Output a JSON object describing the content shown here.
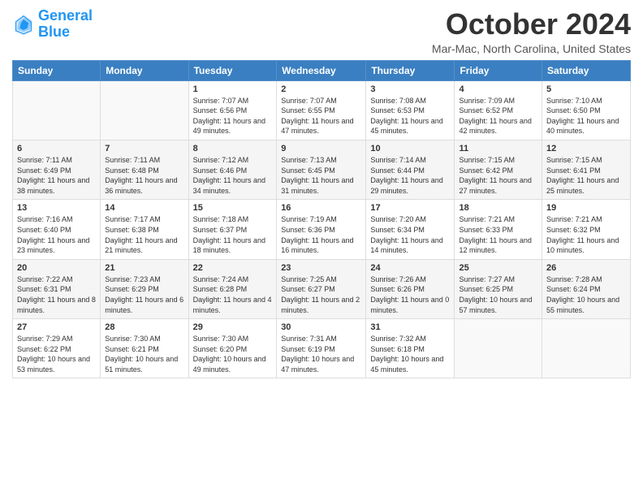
{
  "logo": {
    "line1": "General",
    "line2": "Blue"
  },
  "title": "October 2024",
  "location": "Mar-Mac, North Carolina, United States",
  "weekdays": [
    "Sunday",
    "Monday",
    "Tuesday",
    "Wednesday",
    "Thursday",
    "Friday",
    "Saturday"
  ],
  "weeks": [
    [
      {
        "day": "",
        "sunrise": "",
        "sunset": "",
        "daylight": ""
      },
      {
        "day": "",
        "sunrise": "",
        "sunset": "",
        "daylight": ""
      },
      {
        "day": "1",
        "sunrise": "Sunrise: 7:07 AM",
        "sunset": "Sunset: 6:56 PM",
        "daylight": "Daylight: 11 hours and 49 minutes."
      },
      {
        "day": "2",
        "sunrise": "Sunrise: 7:07 AM",
        "sunset": "Sunset: 6:55 PM",
        "daylight": "Daylight: 11 hours and 47 minutes."
      },
      {
        "day": "3",
        "sunrise": "Sunrise: 7:08 AM",
        "sunset": "Sunset: 6:53 PM",
        "daylight": "Daylight: 11 hours and 45 minutes."
      },
      {
        "day": "4",
        "sunrise": "Sunrise: 7:09 AM",
        "sunset": "Sunset: 6:52 PM",
        "daylight": "Daylight: 11 hours and 42 minutes."
      },
      {
        "day": "5",
        "sunrise": "Sunrise: 7:10 AM",
        "sunset": "Sunset: 6:50 PM",
        "daylight": "Daylight: 11 hours and 40 minutes."
      }
    ],
    [
      {
        "day": "6",
        "sunrise": "Sunrise: 7:11 AM",
        "sunset": "Sunset: 6:49 PM",
        "daylight": "Daylight: 11 hours and 38 minutes."
      },
      {
        "day": "7",
        "sunrise": "Sunrise: 7:11 AM",
        "sunset": "Sunset: 6:48 PM",
        "daylight": "Daylight: 11 hours and 36 minutes."
      },
      {
        "day": "8",
        "sunrise": "Sunrise: 7:12 AM",
        "sunset": "Sunset: 6:46 PM",
        "daylight": "Daylight: 11 hours and 34 minutes."
      },
      {
        "day": "9",
        "sunrise": "Sunrise: 7:13 AM",
        "sunset": "Sunset: 6:45 PM",
        "daylight": "Daylight: 11 hours and 31 minutes."
      },
      {
        "day": "10",
        "sunrise": "Sunrise: 7:14 AM",
        "sunset": "Sunset: 6:44 PM",
        "daylight": "Daylight: 11 hours and 29 minutes."
      },
      {
        "day": "11",
        "sunrise": "Sunrise: 7:15 AM",
        "sunset": "Sunset: 6:42 PM",
        "daylight": "Daylight: 11 hours and 27 minutes."
      },
      {
        "day": "12",
        "sunrise": "Sunrise: 7:15 AM",
        "sunset": "Sunset: 6:41 PM",
        "daylight": "Daylight: 11 hours and 25 minutes."
      }
    ],
    [
      {
        "day": "13",
        "sunrise": "Sunrise: 7:16 AM",
        "sunset": "Sunset: 6:40 PM",
        "daylight": "Daylight: 11 hours and 23 minutes."
      },
      {
        "day": "14",
        "sunrise": "Sunrise: 7:17 AM",
        "sunset": "Sunset: 6:38 PM",
        "daylight": "Daylight: 11 hours and 21 minutes."
      },
      {
        "day": "15",
        "sunrise": "Sunrise: 7:18 AM",
        "sunset": "Sunset: 6:37 PM",
        "daylight": "Daylight: 11 hours and 18 minutes."
      },
      {
        "day": "16",
        "sunrise": "Sunrise: 7:19 AM",
        "sunset": "Sunset: 6:36 PM",
        "daylight": "Daylight: 11 hours and 16 minutes."
      },
      {
        "day": "17",
        "sunrise": "Sunrise: 7:20 AM",
        "sunset": "Sunset: 6:34 PM",
        "daylight": "Daylight: 11 hours and 14 minutes."
      },
      {
        "day": "18",
        "sunrise": "Sunrise: 7:21 AM",
        "sunset": "Sunset: 6:33 PM",
        "daylight": "Daylight: 11 hours and 12 minutes."
      },
      {
        "day": "19",
        "sunrise": "Sunrise: 7:21 AM",
        "sunset": "Sunset: 6:32 PM",
        "daylight": "Daylight: 11 hours and 10 minutes."
      }
    ],
    [
      {
        "day": "20",
        "sunrise": "Sunrise: 7:22 AM",
        "sunset": "Sunset: 6:31 PM",
        "daylight": "Daylight: 11 hours and 8 minutes."
      },
      {
        "day": "21",
        "sunrise": "Sunrise: 7:23 AM",
        "sunset": "Sunset: 6:29 PM",
        "daylight": "Daylight: 11 hours and 6 minutes."
      },
      {
        "day": "22",
        "sunrise": "Sunrise: 7:24 AM",
        "sunset": "Sunset: 6:28 PM",
        "daylight": "Daylight: 11 hours and 4 minutes."
      },
      {
        "day": "23",
        "sunrise": "Sunrise: 7:25 AM",
        "sunset": "Sunset: 6:27 PM",
        "daylight": "Daylight: 11 hours and 2 minutes."
      },
      {
        "day": "24",
        "sunrise": "Sunrise: 7:26 AM",
        "sunset": "Sunset: 6:26 PM",
        "daylight": "Daylight: 11 hours and 0 minutes."
      },
      {
        "day": "25",
        "sunrise": "Sunrise: 7:27 AM",
        "sunset": "Sunset: 6:25 PM",
        "daylight": "Daylight: 10 hours and 57 minutes."
      },
      {
        "day": "26",
        "sunrise": "Sunrise: 7:28 AM",
        "sunset": "Sunset: 6:24 PM",
        "daylight": "Daylight: 10 hours and 55 minutes."
      }
    ],
    [
      {
        "day": "27",
        "sunrise": "Sunrise: 7:29 AM",
        "sunset": "Sunset: 6:22 PM",
        "daylight": "Daylight: 10 hours and 53 minutes."
      },
      {
        "day": "28",
        "sunrise": "Sunrise: 7:30 AM",
        "sunset": "Sunset: 6:21 PM",
        "daylight": "Daylight: 10 hours and 51 minutes."
      },
      {
        "day": "29",
        "sunrise": "Sunrise: 7:30 AM",
        "sunset": "Sunset: 6:20 PM",
        "daylight": "Daylight: 10 hours and 49 minutes."
      },
      {
        "day": "30",
        "sunrise": "Sunrise: 7:31 AM",
        "sunset": "Sunset: 6:19 PM",
        "daylight": "Daylight: 10 hours and 47 minutes."
      },
      {
        "day": "31",
        "sunrise": "Sunrise: 7:32 AM",
        "sunset": "Sunset: 6:18 PM",
        "daylight": "Daylight: 10 hours and 45 minutes."
      },
      {
        "day": "",
        "sunrise": "",
        "sunset": "",
        "daylight": ""
      },
      {
        "day": "",
        "sunrise": "",
        "sunset": "",
        "daylight": ""
      }
    ]
  ]
}
